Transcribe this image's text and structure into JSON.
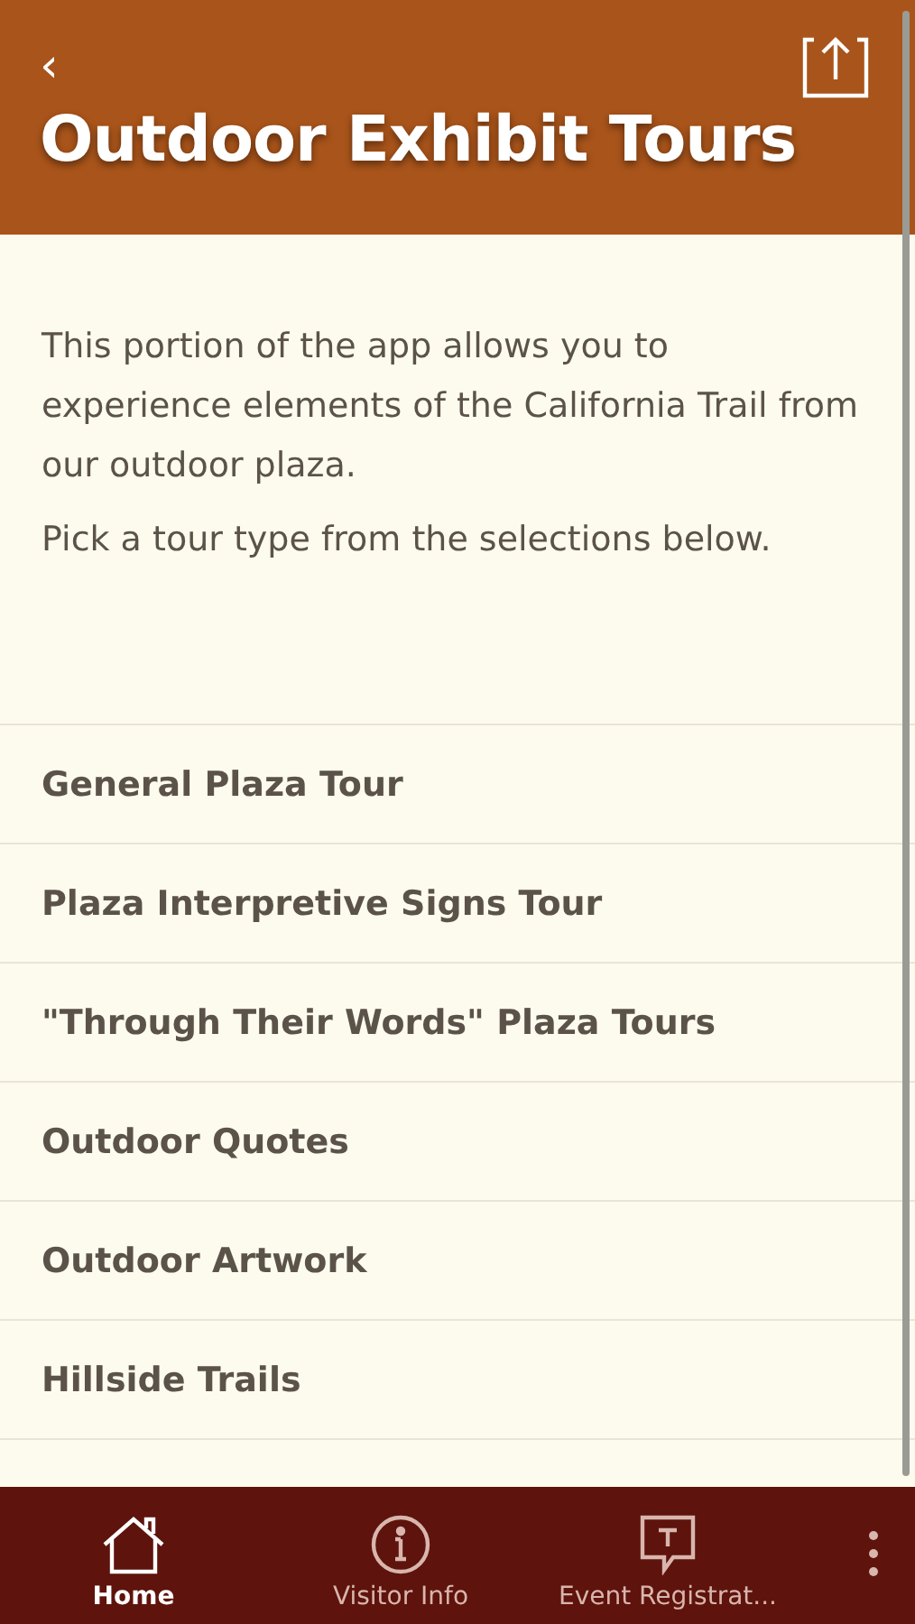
{
  "header": {
    "back": "‹",
    "title": "Outdoor Exhibit Tours"
  },
  "intro": [
    "This portion of the app allows you to experience elements of the California Trail from our outdoor plaza.",
    "Pick a tour type from the selections below."
  ],
  "tours": [
    "General Plaza Tour",
    "Plaza Interpretive Signs Tour",
    "\"Through Their Words\" Plaza Tours",
    "Outdoor Quotes",
    "Outdoor Artwork",
    "Hillside Trails"
  ],
  "tabs": [
    {
      "label": "Home",
      "kind": "home",
      "selected": true
    },
    {
      "label": "Visitor Info",
      "kind": "info",
      "selected": false
    },
    {
      "label": "Event Registrat...",
      "kind": "chat",
      "selected": false
    }
  ]
}
